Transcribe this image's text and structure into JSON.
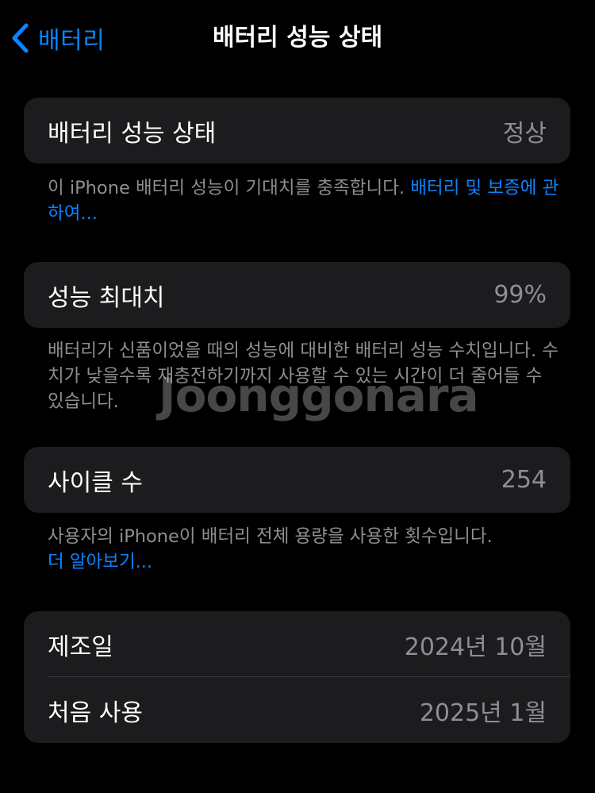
{
  "nav": {
    "back_label": "배터리",
    "title": "배터리 성능 상태"
  },
  "health_group": {
    "label": "배터리 성능 상태",
    "value": "정상",
    "footer_text": "이 iPhone 배터리 성능이 기대치를 충족합니다. ",
    "footer_link": "배터리 및 보증에 관하여..."
  },
  "capacity_group": {
    "label": "성능 최대치",
    "value": "99%",
    "footer_text": "배터리가 신품이었을 때의 성능에 대비한 배터리 성능 수치입니다. 수치가 낮을수록 재충전하기까지 사용할 수 있는 시간이 더 줄어들 수 있습니다."
  },
  "cycle_group": {
    "label": "사이클 수",
    "value": "254",
    "footer_text": "사용자의 iPhone이 배터리 전체 용량을 사용한 횟수입니다.",
    "footer_link": "더 알아보기..."
  },
  "dates_group": {
    "rows": [
      {
        "label": "제조일",
        "value": "2024년 10월"
      },
      {
        "label": "처음 사용",
        "value": "2025년 1월"
      }
    ]
  },
  "watermark": "Joonggonara",
  "colors": {
    "background": "#000000",
    "card": "#1c1c1e",
    "accent": "#0a84ff",
    "secondary_text": "#8e8e93"
  },
  "icons": {
    "back": "chevron-left-icon"
  }
}
